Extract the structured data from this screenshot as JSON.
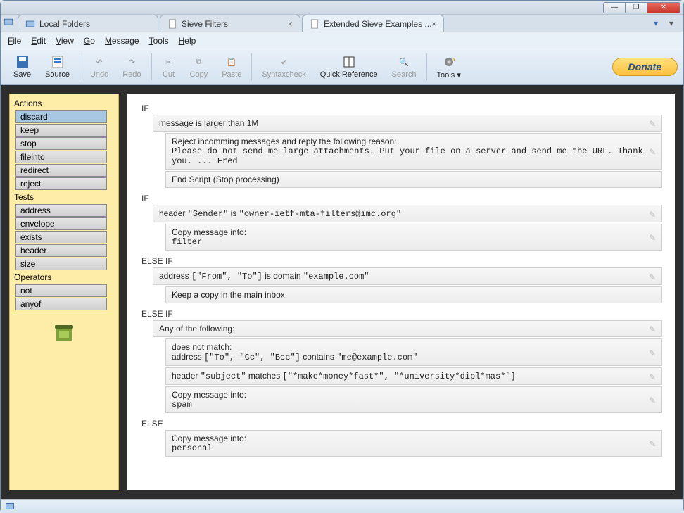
{
  "window": {
    "tabs": [
      {
        "label": "Local Folders"
      },
      {
        "label": "Sieve Filters"
      },
      {
        "label": "Extended Sieve Examples ..."
      }
    ]
  },
  "menubar": [
    "File",
    "Edit",
    "View",
    "Go",
    "Message",
    "Tools",
    "Help"
  ],
  "toolbar": {
    "save": "Save",
    "source": "Source",
    "undo": "Undo",
    "redo": "Redo",
    "cut": "Cut",
    "copy": "Copy",
    "paste": "Paste",
    "syntaxcheck": "Syntaxcheck",
    "quickref": "Quick Reference",
    "search": "Search",
    "tools": "Tools",
    "donate": "Donate"
  },
  "sidebar": {
    "actions_title": "Actions",
    "actions": [
      "discard",
      "keep",
      "stop",
      "fileinto",
      "redirect",
      "reject"
    ],
    "tests_title": "Tests",
    "tests": [
      "address",
      "envelope",
      "exists",
      "header",
      "size"
    ],
    "operators_title": "Operators",
    "operators": [
      "not",
      "anyof"
    ]
  },
  "editor": {
    "blocks": [
      {
        "cond": "IF",
        "headline": "message is larger than 1M",
        "actions": [
          {
            "title": "Reject incomming messages and reply the following reason:",
            "body": "Please do not send me large attachments. Put your file on a server and send me the URL. Thank you. ... Fred"
          },
          {
            "title": "End Script (Stop processing)"
          }
        ]
      },
      {
        "cond": "IF",
        "headline": "header \"Sender\" is \"owner-ietf-mta-filters@imc.org\"",
        "headline_mono_prefix": "header ",
        "actions": [
          {
            "title": "Copy message into:",
            "body": "filter"
          }
        ]
      },
      {
        "cond": "ELSE IF",
        "headline": "address [\"From\", \"To\"] is domain \"example.com\"",
        "actions": [
          {
            "title": "Keep a copy in the main inbox"
          }
        ]
      },
      {
        "cond": "ELSE IF",
        "headline": "Any of the following:",
        "subtests": [
          {
            "title": "does not match:",
            "body": "address [\"To\", \"Cc\", \"Bcc\"] contains \"me@example.com\""
          },
          {
            "title_mono": "header \"subject\" matches [\"*make*money*fast*\", \"*university*dipl*mas*\"]"
          }
        ],
        "actions": [
          {
            "title": "Copy message into:",
            "body": "spam"
          }
        ]
      },
      {
        "cond": "ELSE",
        "actions": [
          {
            "title": "Copy message into:",
            "body": "personal"
          }
        ]
      }
    ]
  }
}
